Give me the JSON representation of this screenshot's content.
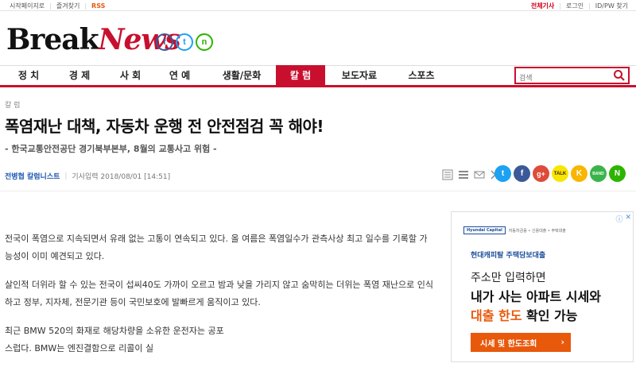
{
  "topbar": {
    "left": [
      "시작페이지로",
      "즐겨찾기",
      "RSS"
    ],
    "right": [
      "전체기사",
      "로그인",
      "ID/PW 찾기"
    ]
  },
  "logo": {
    "part1": "Break",
    "part2": "News"
  },
  "social_top": [
    "f",
    "t",
    "n"
  ],
  "nav": {
    "items": [
      "정 치",
      "경 제",
      "사 회",
      "연 예",
      "생활/문화",
      "칼 럼",
      "보도자료",
      "스포츠"
    ],
    "active_index": 5
  },
  "search": {
    "placeholder": "검색"
  },
  "article": {
    "category": "칼 럼",
    "headline": "폭염재난 대책, 자동차 운행 전 안전점검 꼭 해야!",
    "subhead": "- 한국교통안전공단 경기북부본부, 8월의 교통사고 위험 -",
    "author": "전병협 칼럼니스트",
    "date_label": "기사입력 2018/08/01 [14:51]",
    "paragraphs": [
      "전국이 폭염으로 지속되면서 유래 없는 고통이 연속되고 있다. 올 여름은 폭염일수가 관측사상 최고 일수를 기록할 가능성이 이미 예견되고 있다.",
      "살인적 더위라 할 수 있는 전국이 섭씨40도 가까이 오르고 밤과 낮을 가리지 않고 숨막히는 더위는 폭염 재난으로 인식하고 정부, 지자체, 전문기관 등이 국민보호에 발빠르게 움직이고 있다.",
      "최근 BMW 520의 화재로 해당차량을 소유한 운전자는 공포스럽다. BMW는 엔진결함으로 리콜이 실"
    ]
  },
  "share": {
    "icons": [
      "t",
      "f",
      "g+",
      "TALK",
      "K",
      "BAND",
      "N"
    ]
  },
  "ad": {
    "brand": "Hyundai Capital",
    "brand_sub": "자동차금융 • 신용대출 • 주택대출",
    "tagline": "현대캐피탈 주택담보대출",
    "line1": "주소만 입력하면",
    "line2": "내가 사는 아파트 시세와",
    "line3_highlight": "대출 한도",
    "line3_rest": " 확인 가능",
    "cta": "시세 및 한도조회",
    "cta_chevron": "›",
    "adchoices": [
      "ⓘ",
      "✕"
    ]
  },
  "colors": {
    "brand_red": "#c8102e",
    "link_blue": "#1a56b0",
    "ad_orange": "#e8590c"
  }
}
